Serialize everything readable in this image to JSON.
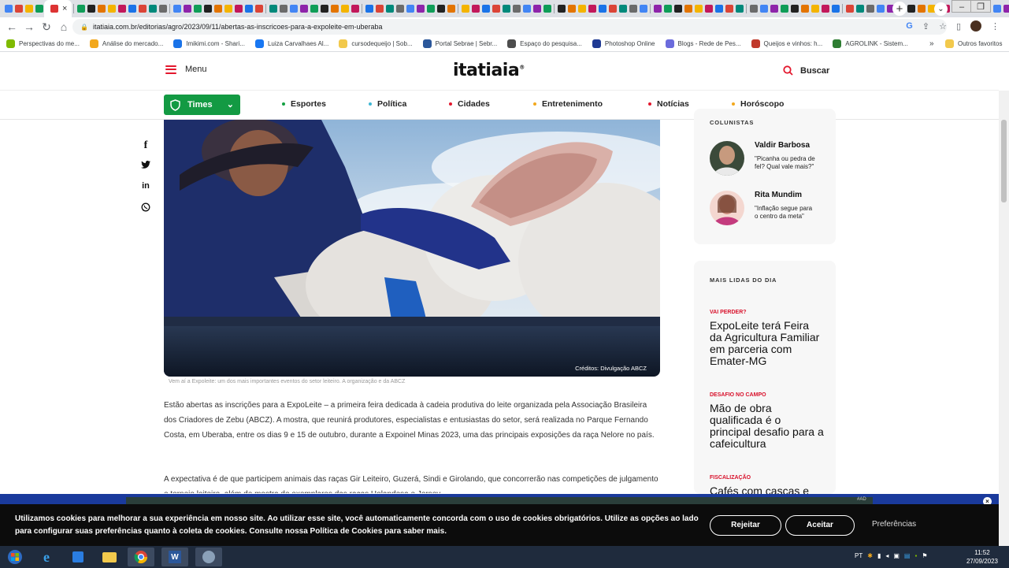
{
  "browser": {
    "active_tab_close": "×",
    "new_tab": "+",
    "url": "itatiaia.com.br/editorias/agro/2023/09/11/abertas-as-inscricoes-para-a-expoleite-em-uberaba",
    "bookmarks": [
      "Perspectivas do me...",
      "Análise do mercado...",
      "Imikimi.com - Shari...",
      "Luiza Carvalhaes Al...",
      "cursodequeijo | Sob...",
      "Portal Sebrae | Sebr...",
      "Espaço do pesquisa...",
      "Photoshop Online",
      "Blogs - Rede de Pes...",
      "Queijos e vinhos: h...",
      "AGROLINK - Sistem..."
    ],
    "bookmarks_more": "»",
    "other_bookmarks": "Outros favoritos"
  },
  "header": {
    "menu_label": "Menu",
    "logo": "itatiaia",
    "logo_mark": "®",
    "search_label": "Buscar"
  },
  "nav": {
    "times_label": "Times",
    "categories": [
      {
        "label": "Esportes",
        "color": "#13a042"
      },
      {
        "label": "Política",
        "color": "#3fb7d4"
      },
      {
        "label": "Cidades",
        "color": "#e3172d"
      },
      {
        "label": "Entretenimento",
        "color": "#f2a81d"
      },
      {
        "label": "Notícias",
        "color": "#e3172d"
      },
      {
        "label": "Horóscopo",
        "color": "#f2a81d"
      }
    ]
  },
  "article": {
    "image_credit": "Créditos: Divulgação ABCZ",
    "caption": "Vem aí a Expoleite: um dos mais importantes eventos do setor leiteiro. A organização e da ABCZ",
    "paragraph_1": "Estão abertas as inscrições para a ExpoLeite – a primeira feira dedicada à cadeia produtiva do leite organizada pela Associação Brasileira dos Criadores de Zebu (ABCZ). A mostra, que reunirá produtores, especialistas e entusiastas do setor, será realizada no Parque Fernando Costa, em Uberaba, entre os dias 9 e 15 de outubro, durante a Expoinel Minas 2023, uma das principais exposições da raça Nelore no país.",
    "paragraph_2": "A expectativa é de que participem animais das raças Gir Leiteiro, Guzerá, Sindi e Girolando, que concorrerão nas competições de julgamento e torneio leiteiro, além de mostra de exemplares das raças Holandesa e Jersey."
  },
  "sidebar": {
    "columnists_heading": "COLUNISTAS",
    "columnists": [
      {
        "name": "Valdir Barbosa",
        "quote": "\"Picanha ou pedra de fel? Qual vale mais?\""
      },
      {
        "name": "Rita Mundim",
        "quote": "\"Inflação segue para o centro da meta\""
      }
    ],
    "most_read_heading": "MAIS LIDAS DO DIA",
    "most_read": [
      {
        "kicker": "VAI PERDER?",
        "title": "ExpoLeite terá Feira da Agricultura Familiar em parceria com Emater-MG"
      },
      {
        "kicker": "DESAFIO NO CAMPO",
        "title": "Mão de obra qualificada é o principal desafio para a cafeicultura"
      },
      {
        "kicker": "FISCALIZAÇÃO",
        "title": "Cafés com cascas e"
      }
    ]
  },
  "ad": {
    "tag": "#AD",
    "close": "×"
  },
  "cookie": {
    "text": "Utilizamos cookies para melhorar a sua experiência em nosso site. Ao utilizar esse site, você automaticamente concorda com o uso de cookies obrigatórios. Utilize as opções ao lado para configurar suas preferências quanto à coleta de cookies. Consulte nossa Política de Cookies para saber mais.",
    "reject": "Rejeitar",
    "accept": "Aceitar",
    "preferences": "Preferências"
  },
  "taskbar": {
    "lang": "PT",
    "time": "11:52",
    "date": "27/09/2023"
  }
}
